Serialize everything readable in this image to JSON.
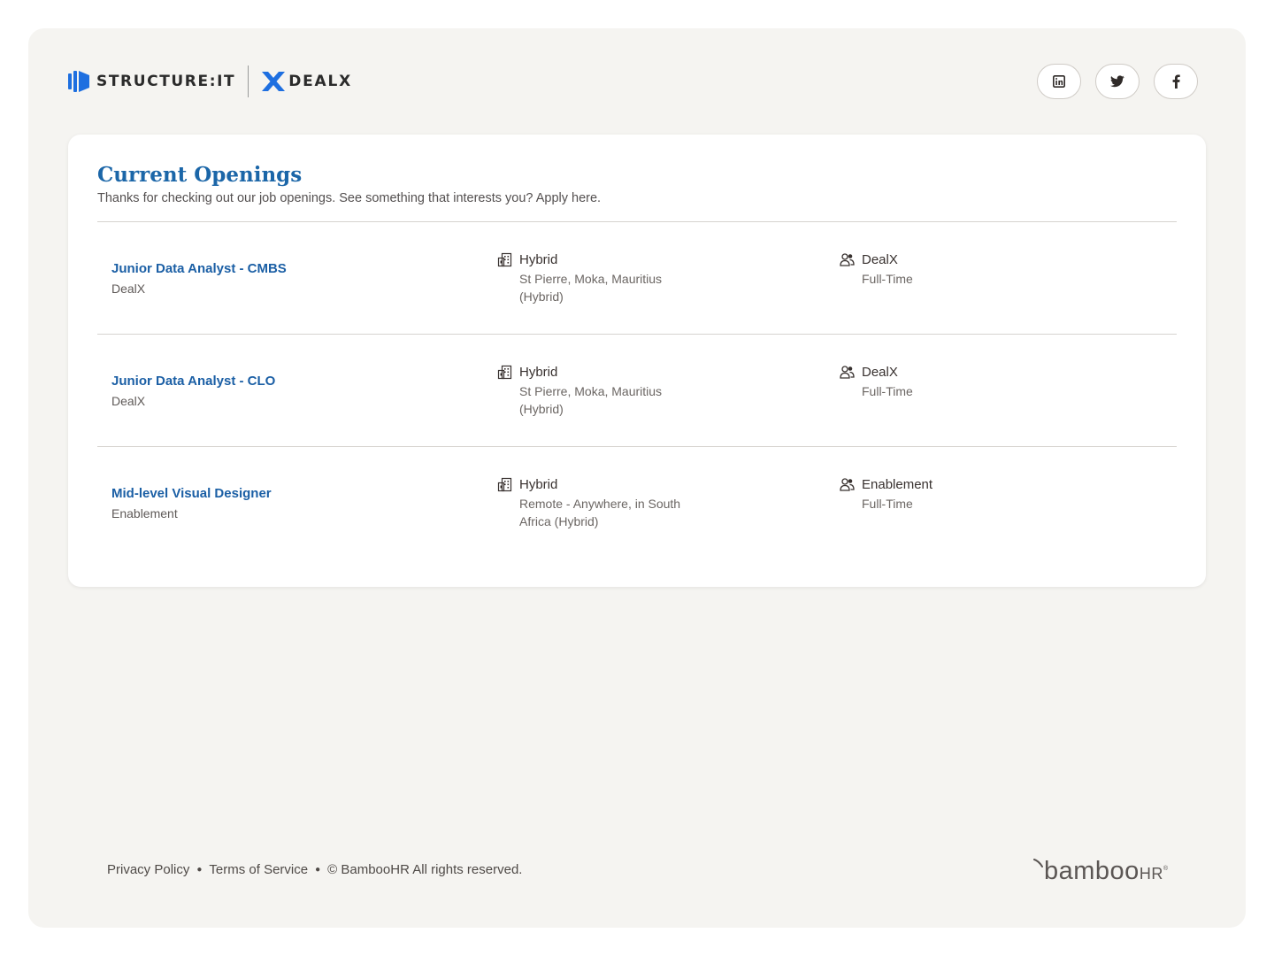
{
  "header": {
    "logo_structure_text": "STRUCTURE:IT",
    "logo_dealx_text": "DEALX",
    "socials": [
      {
        "icon": "linkedin-icon"
      },
      {
        "icon": "twitter-icon"
      },
      {
        "icon": "facebook-icon"
      }
    ]
  },
  "openings": {
    "title": "Current Openings",
    "subtitle": "Thanks for checking out our job openings. See something that interests you? Apply here.",
    "jobs": [
      {
        "title": "Junior Data Analyst - CMBS",
        "department": "DealX",
        "location_type": "Hybrid",
        "location": "St Pierre, Moka, Mauritius",
        "location_note": "(Hybrid)",
        "team": "DealX",
        "employment": "Full-Time"
      },
      {
        "title": "Junior Data Analyst - CLO",
        "department": "DealX",
        "location_type": "Hybrid",
        "location": "St Pierre, Moka, Mauritius",
        "location_note": "(Hybrid)",
        "team": "DealX",
        "employment": "Full-Time"
      },
      {
        "title": "Mid-level Visual Designer",
        "department": "Enablement",
        "location_type": "Hybrid",
        "location": "Remote - Anywhere, in South",
        "location_note": "Africa (Hybrid)",
        "team": "Enablement",
        "employment": "Full-Time"
      }
    ]
  },
  "footer": {
    "privacy": "Privacy Policy",
    "terms": "Terms of Service",
    "copyright": "© BambooHR All rights reserved.",
    "brand_main": "bamboo",
    "brand_suffix": "HR"
  },
  "colors": {
    "accent": "#1b66a8",
    "frame_bg": "#f5f4f1",
    "card_bg": "#ffffff",
    "structure_blue": "#1e6fe0"
  }
}
